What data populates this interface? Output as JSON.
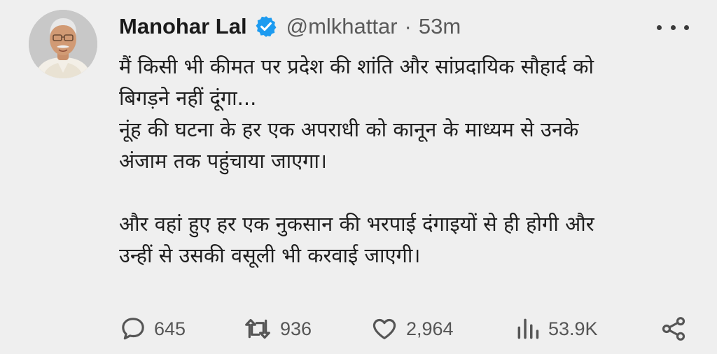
{
  "author": {
    "display_name": "Manohar Lal",
    "handle": "@mlkhattar",
    "separator": "·",
    "time": "53m",
    "verified_color": "#1d9bf0"
  },
  "tweet": {
    "lines": [
      "मैं किसी भी कीमत पर प्रदेश की शांति और सांप्रदायिक सौहार्द को",
      "बिगड़ने नहीं दूंगा...",
      "नूंह की घटना के हर एक अपराधी को कानून के माध्यम से उनके",
      "अंजाम तक पहुंचाया जाएगा।",
      "और वहां हुए हर एक नुकसान की भरपाई दंगाइयों से ही होगी और",
      "उन्हीं से उसकी वसूली भी करवाई जाएगी।"
    ]
  },
  "actions": {
    "replies": "645",
    "retweets": "936",
    "likes": "2,964",
    "views": "53.9K"
  },
  "icons": {
    "more": "more-horizontal-icon",
    "reply": "comment-icon",
    "retweet": "retweet-icon",
    "like": "heart-icon",
    "views": "bar-chart-icon",
    "share": "share-icon"
  }
}
